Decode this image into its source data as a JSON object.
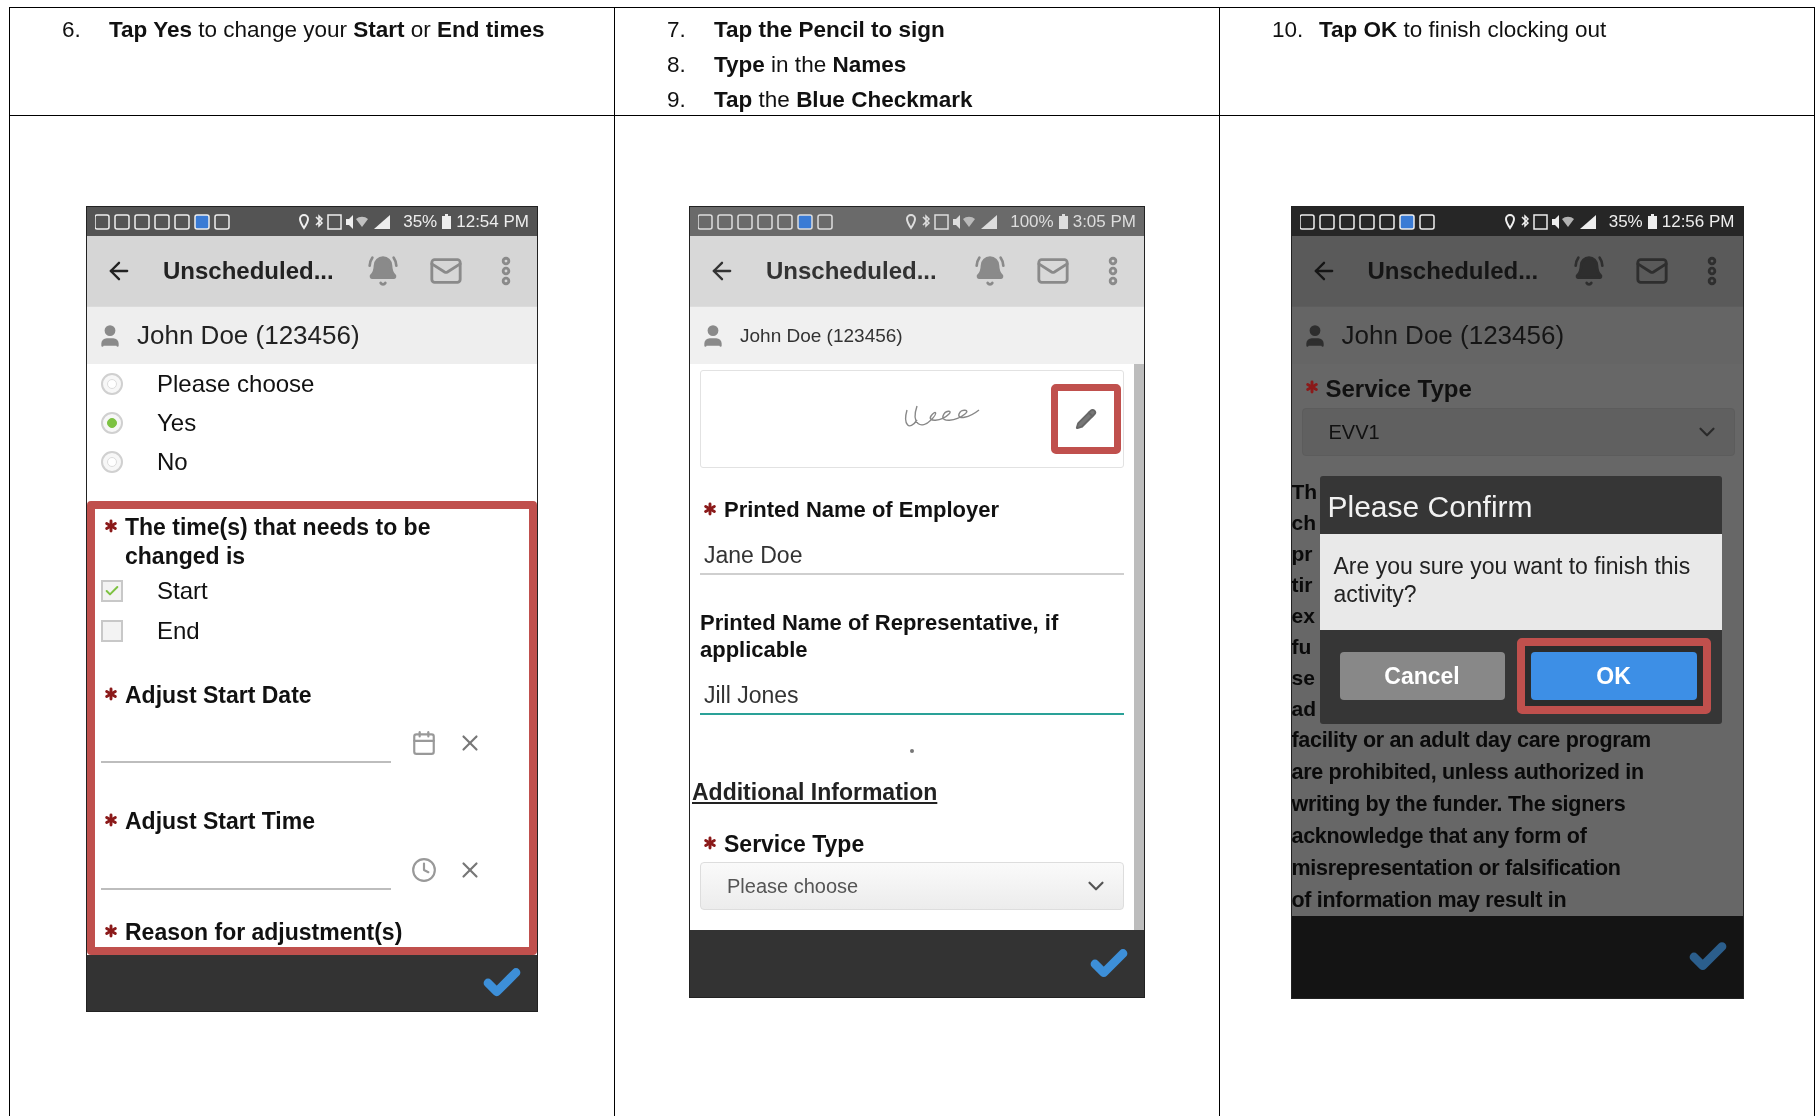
{
  "columns": [
    {
      "instructions": [
        {
          "number": "6.",
          "text": "**Tap Yes** to change your **Start** or **End times**",
          "bold": false
        }
      ],
      "screen": {
        "kind": "adjust",
        "status_bar": {
          "battery": "35%",
          "time": "12:54 PM"
        },
        "app_bar": {
          "title": "Unscheduled..."
        },
        "user": "John Doe (123456)",
        "radios": [
          {
            "label": "Please choose",
            "selected": false
          },
          {
            "label": "Yes",
            "selected": true
          },
          {
            "label": "No",
            "selected": false
          }
        ],
        "question": {
          "label": "The time(s) that needs to be changed is",
          "required": true
        },
        "checkboxes": [
          {
            "label": "Start",
            "checked": true
          },
          {
            "label": "End",
            "checked": false
          }
        ],
        "fields": [
          {
            "label": "Adjust Start Date",
            "required": true,
            "kind": "date"
          },
          {
            "label": "Adjust Start Time",
            "required": true,
            "kind": "time"
          }
        ],
        "next_label": {
          "label": "Reason for adjustment(s)",
          "required": true
        }
      }
    },
    {
      "instructions": [
        {
          "number": "7.",
          "text": "Tap the Pencil to sign",
          "bold": true
        },
        {
          "number": "8.",
          "text": "**Type** in the **Names**",
          "bold": false
        },
        {
          "number": "9.",
          "text": "**Tap** the **Blue Checkmark**",
          "bold": false
        }
      ],
      "screen": {
        "kind": "signature",
        "status_bar": {
          "battery": "100%",
          "time": "3:05 PM"
        },
        "app_bar": {
          "title": "Unscheduled..."
        },
        "user": "John Doe (123456)",
        "fields": [
          {
            "label": "Printed Name of Employer",
            "required": true,
            "value": "Jane Doe",
            "focused": false
          },
          {
            "label": "Printed Name of Representative, if applicable",
            "required": false,
            "value": "Jill Jones",
            "focused": true
          }
        ],
        "section": "Additional Information",
        "select": {
          "label": "Service Type",
          "required": true,
          "value": "Please choose"
        }
      }
    },
    {
      "instructions": [
        {
          "number": "10.",
          "text": "**Tap OK** to finish clocking out",
          "bold": false
        }
      ],
      "screen": {
        "kind": "confirm",
        "status_bar": {
          "battery": "35%",
          "time": "12:56 PM"
        },
        "app_bar": {
          "title": "Unscheduled..."
        },
        "user": "John Doe (123456)",
        "select": {
          "label": "Service Type",
          "required": true,
          "value": "EVV1"
        },
        "fragments": [
          "Th",
          "ch",
          "pr",
          "tir",
          "ex",
          "fu",
          "se",
          "ad"
        ],
        "text_lines": [
          "facility or an adult day care program",
          "are prohibited, unless authorized in",
          "writing by the funder. The signers",
          "acknowledge that any form of",
          "misrepresentation or falsification",
          "of information may result in"
        ],
        "dialog": {
          "title": "Please Confirm",
          "message": "Are you sure you want to finish this activity?",
          "buttons": [
            {
              "label": "Cancel",
              "kind": "secondary"
            },
            {
              "label": "OK",
              "kind": "primary"
            }
          ]
        }
      }
    }
  ]
}
